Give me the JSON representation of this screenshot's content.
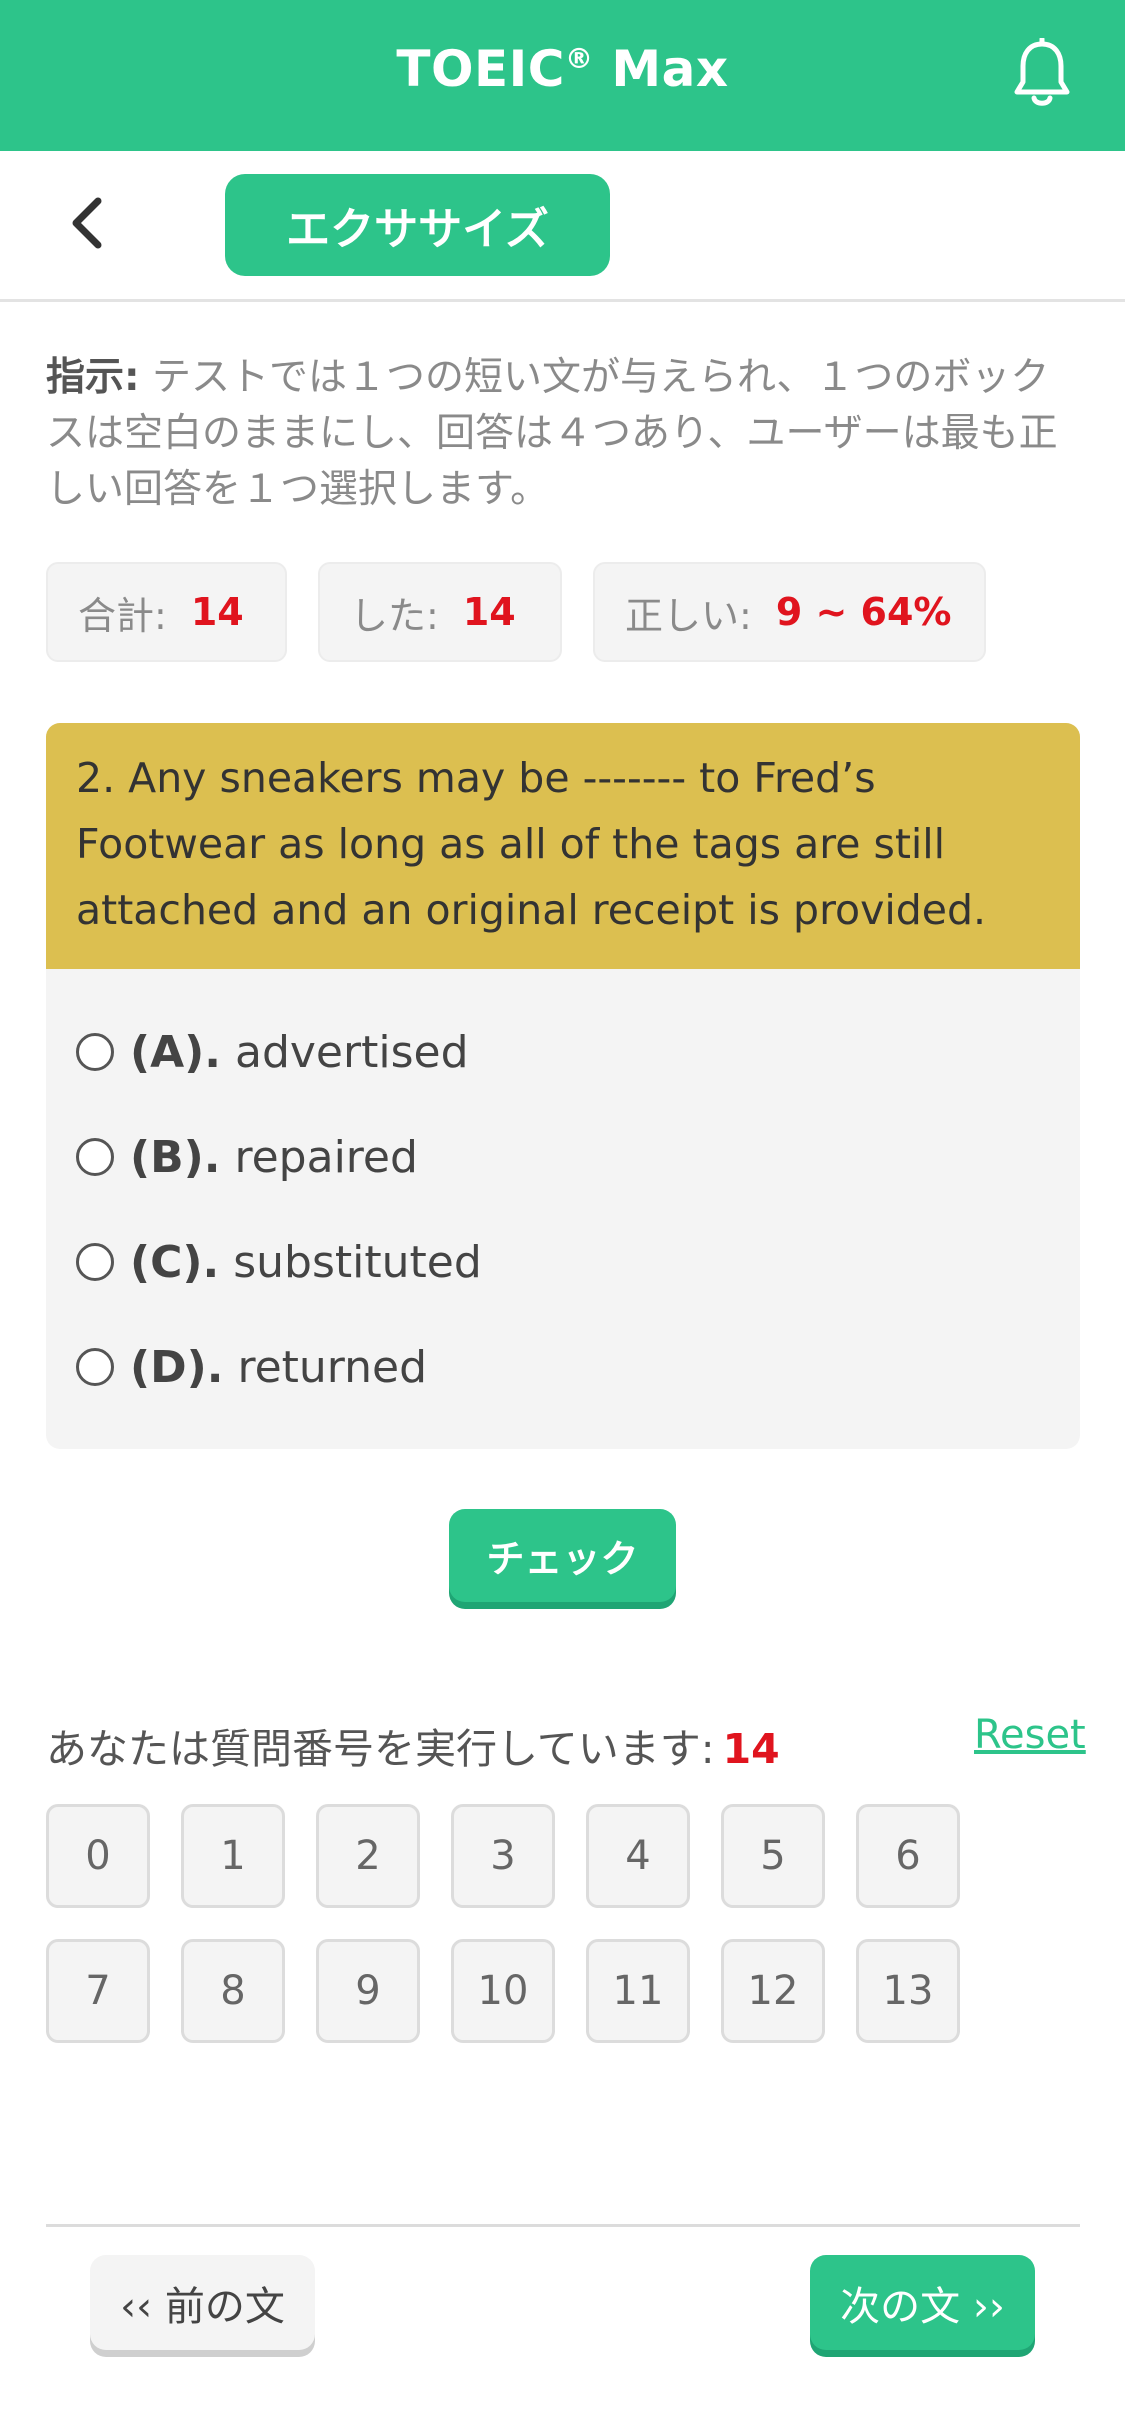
{
  "app": {
    "title": "TOEIC",
    "title_mark": "®",
    "title_suffix": " Max",
    "bell_icon": "bell-icon",
    "accent_color": "#2dc48a"
  },
  "subbar": {
    "back_icon": "chevron-left-icon",
    "tab_label": "エクササイズ"
  },
  "instructions": {
    "label": "指示:",
    "text": " テストでは１つの短い文が与えられ、１つのボックスは空白のままにし、回答は４つあり、ユーザーは最も正しい回答を１つ選択します。"
  },
  "stats": {
    "total_label": "合計:",
    "total_value": "14",
    "done_label": "した:",
    "done_value": "14",
    "correct_label": "正しい:",
    "correct_value": "9 ~ 64%"
  },
  "question": {
    "text": "2. Any sneakers may be ------- to Fred’s Footwear as long as all of the tags are still attached and an original receipt is provided.",
    "options": [
      {
        "letter": "(A).",
        "text": "advertised"
      },
      {
        "letter": "(B).",
        "text": "repaired"
      },
      {
        "letter": "(C).",
        "text": "substituted"
      },
      {
        "letter": "(D).",
        "text": "returned"
      }
    ]
  },
  "check_button": "チェック",
  "progress": {
    "label": "あなたは質問番号を実行しています:",
    "current": "14",
    "reset": "Reset"
  },
  "question_numbers": [
    "0",
    "1",
    "2",
    "3",
    "4",
    "5",
    "6",
    "7",
    "8",
    "9",
    "10",
    "11",
    "12",
    "13"
  ],
  "nav": {
    "prev": "‹‹ 前の文",
    "next": "次の文 ››"
  }
}
